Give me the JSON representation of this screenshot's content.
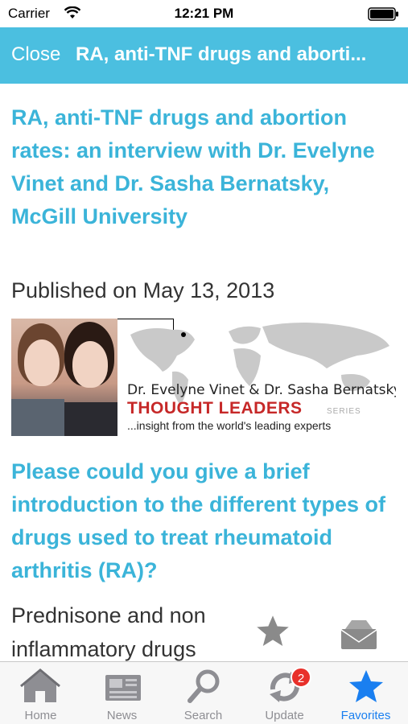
{
  "status_bar": {
    "carrier": "Carrier",
    "time": "12:21 PM",
    "wifi_icon": "wifi-icon",
    "battery_icon": "battery-icon"
  },
  "nav_bar": {
    "close_label": "Close",
    "title": "RA, anti-TNF drugs and aborti..."
  },
  "article": {
    "title": "RA, anti-TNF drugs and abortion rates: an interview with Dr. Evelyne Vinet and Dr. Sasha Bernatsky, McGill University",
    "published": "Published on May 13, 2013",
    "banner": {
      "names": "Dr. Evelyne Vinet & Dr. Sasha Bernatsky",
      "series": "THOUGHT LEADERS",
      "series_tag": "SERIES",
      "tagline": "...insight from the world's leading experts"
    },
    "question": "Please could you give a brief introduction to the different types of drugs used to treat rheumatoid arthritis (RA)?",
    "answer_line1": "Prednisone and non",
    "answer_line2": "inflammatory drugs"
  },
  "floating_actions": {
    "favorite_icon": "star-icon",
    "share_icon": "mail-icon"
  },
  "tab_bar": {
    "tabs": [
      {
        "label": "Home",
        "icon": "home-icon"
      },
      {
        "label": "News",
        "icon": "newspaper-icon"
      },
      {
        "label": "Search",
        "icon": "search-icon"
      },
      {
        "label": "Update",
        "icon": "refresh-icon",
        "badge": "2"
      },
      {
        "label": "Favorites",
        "icon": "star-icon",
        "active": true
      }
    ]
  },
  "colors": {
    "accent": "#3bb4d9",
    "nav_bar": "#4bbfe0",
    "active_tab": "#1a7ff0",
    "badge": "#e8302a",
    "series_red": "#c62828"
  }
}
